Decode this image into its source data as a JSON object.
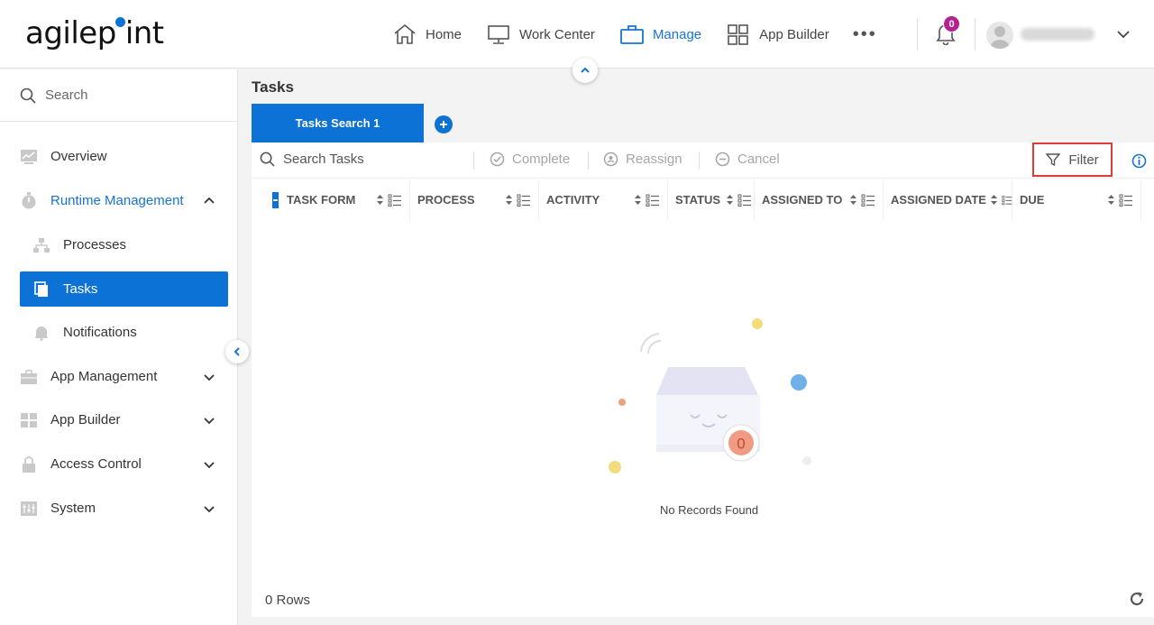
{
  "app": {
    "logo_text": "agilep",
    "logo_text_end": "int"
  },
  "topnav": {
    "home": "Home",
    "work_center": "Work Center",
    "manage": "Manage",
    "app_builder": "App Builder",
    "more": "•••"
  },
  "notifications": {
    "count": "0"
  },
  "sidebar": {
    "search_placeholder": "Search",
    "items": [
      {
        "label": "Overview",
        "icon": "chart-icon"
      },
      {
        "label": "Runtime Management",
        "icon": "stopwatch-icon"
      },
      {
        "label": "Processes",
        "icon": "hierarchy-icon"
      },
      {
        "label": "Tasks",
        "icon": "tasks-icon"
      },
      {
        "label": "Notifications",
        "icon": "bell-icon"
      },
      {
        "label": "App Management",
        "icon": "briefcase-icon"
      },
      {
        "label": "App Builder",
        "icon": "grid-icon"
      },
      {
        "label": "Access Control",
        "icon": "lock-icon"
      },
      {
        "label": "System",
        "icon": "sliders-icon"
      }
    ]
  },
  "main": {
    "page_title": "Tasks",
    "tabs": [
      {
        "label": "Tasks Search 1"
      }
    ],
    "toolbar": {
      "search_placeholder": "Search Tasks",
      "complete": "Complete",
      "reassign": "Reassign",
      "cancel": "Cancel",
      "filter": "Filter"
    },
    "columns": [
      {
        "label": "TASK FORM"
      },
      {
        "label": "PROCESS"
      },
      {
        "label": "ACTIVITY"
      },
      {
        "label": "STATUS"
      },
      {
        "label": "ASSIGNED TO"
      },
      {
        "label": "ASSIGNED DATE"
      },
      {
        "label": "DUE"
      }
    ],
    "empty": {
      "count": "0",
      "message": "No Records Found"
    },
    "footer": {
      "rows": "0 Rows"
    }
  },
  "colors": {
    "accent": "#0d72d6",
    "badge": "#b5218f",
    "filter_highlight": "#e03a3a"
  }
}
